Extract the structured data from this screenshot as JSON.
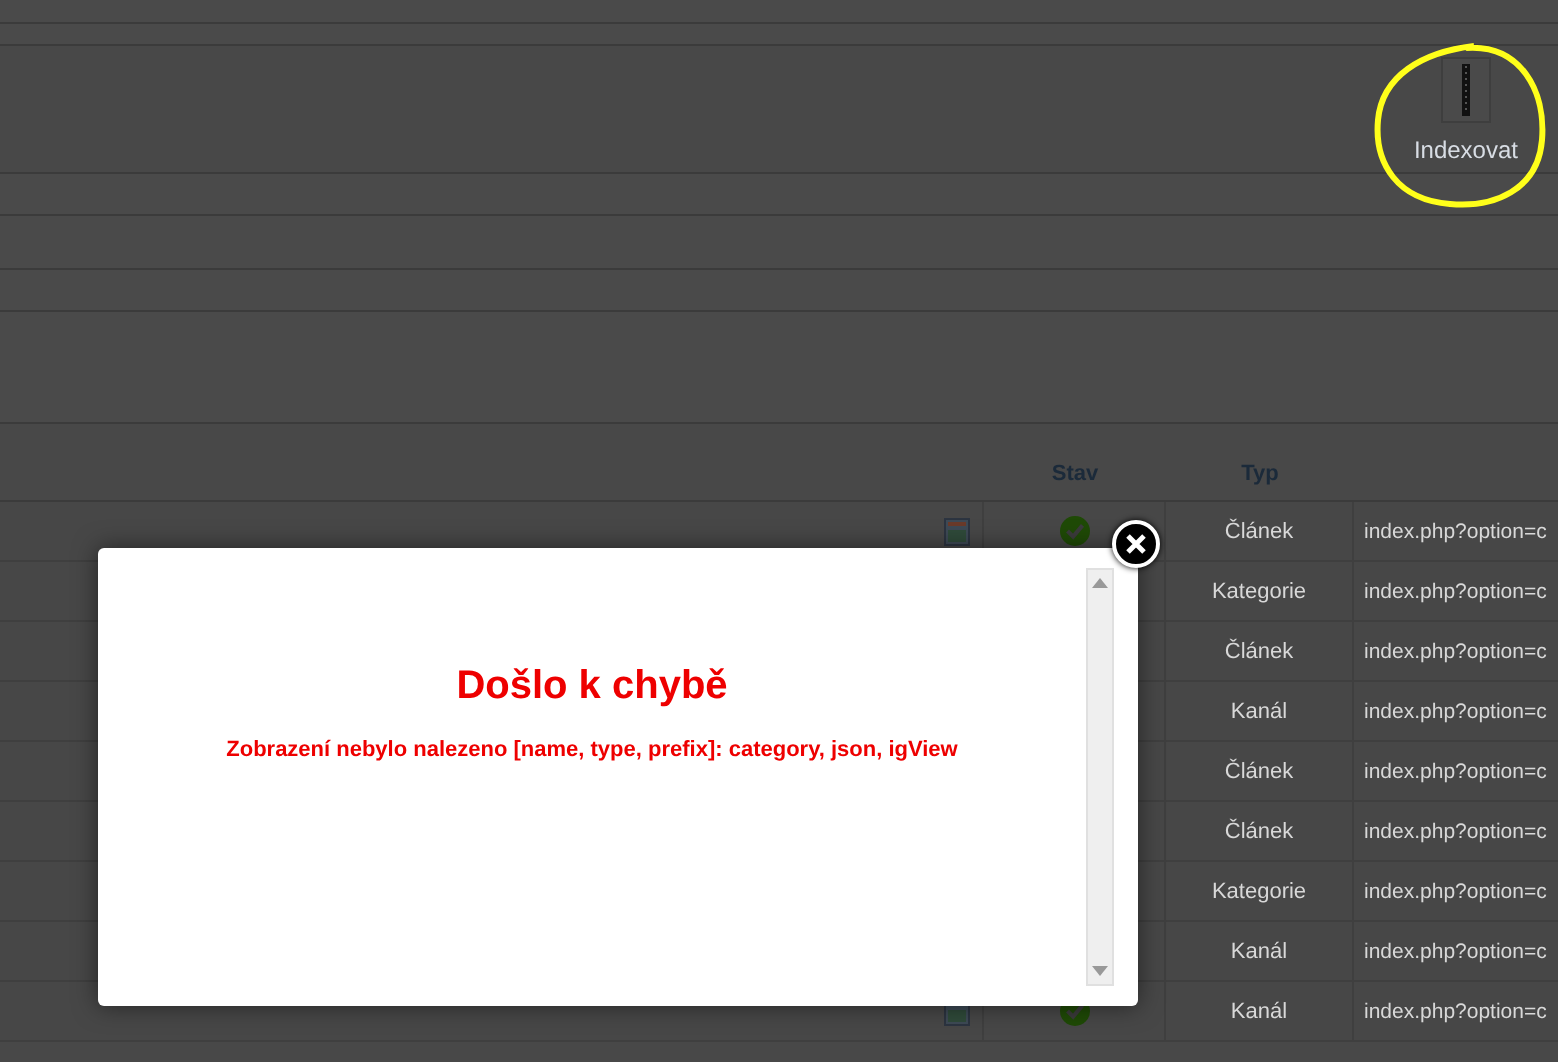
{
  "toolbar": {
    "buttons": [
      {
        "label": "Indexovat"
      }
    ]
  },
  "table": {
    "columns": [
      "Stav",
      "Typ"
    ],
    "rows": [
      {
        "published": true,
        "type": "Článek",
        "link": "index.php?option=c"
      },
      {
        "type": "Kategorie",
        "link": "index.php?option=c"
      },
      {
        "type": "Článek",
        "link": "index.php?option=c"
      },
      {
        "type": "Kanál",
        "link": "index.php?option=c"
      },
      {
        "type": "Článek",
        "link": "index.php?option=c"
      },
      {
        "type": "Článek",
        "link": "index.php?option=c"
      },
      {
        "type": "Kategorie",
        "link": "index.php?option=c"
      },
      {
        "type": "Kanál",
        "link": "index.php?option=c"
      },
      {
        "published": true,
        "type": "Kanál",
        "link": "index.php?option=c"
      }
    ]
  },
  "modal": {
    "title": "Došlo k chybě",
    "message": "Zobrazení nebylo nalezeno [name, type, prefix]: category, json, igView"
  }
}
